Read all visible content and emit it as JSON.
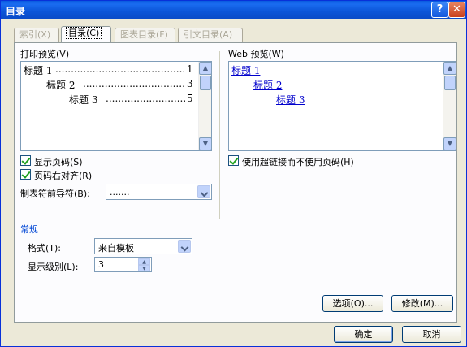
{
  "window": {
    "title": "目录",
    "help_glyph": "?",
    "close_glyph": "✕"
  },
  "tabs": [
    {
      "label": "索引(X)"
    },
    {
      "label": "目录(C)"
    },
    {
      "label": "图表目录(F)"
    },
    {
      "label": "引文目录(A)"
    }
  ],
  "print_preview": {
    "label": "打印预览(V)",
    "entries": [
      {
        "text": "标题 1",
        "page": "1"
      },
      {
        "text": "标题 2",
        "page": "3"
      },
      {
        "text": "标题 3",
        "page": "5"
      }
    ]
  },
  "web_preview": {
    "label": "Web 预览(W)",
    "entries": [
      "标题 1",
      "标题 2",
      "标题 3"
    ]
  },
  "options": {
    "show_page_numbers": "显示页码(S)",
    "right_align": "页码右对齐(R)",
    "tab_leader_label": "制表符前导符(B):",
    "tab_leader_value": ".......",
    "use_hyperlinks": "使用超链接而不使用页码(H)"
  },
  "general": {
    "section": "常规",
    "format_label": "格式(T):",
    "format_value": "来自模板",
    "levels_label": "显示级别(L):",
    "levels_value": "3"
  },
  "buttons": {
    "options": "选项(O)...",
    "modify": "修改(M)...",
    "ok": "确定",
    "cancel": "取消"
  }
}
